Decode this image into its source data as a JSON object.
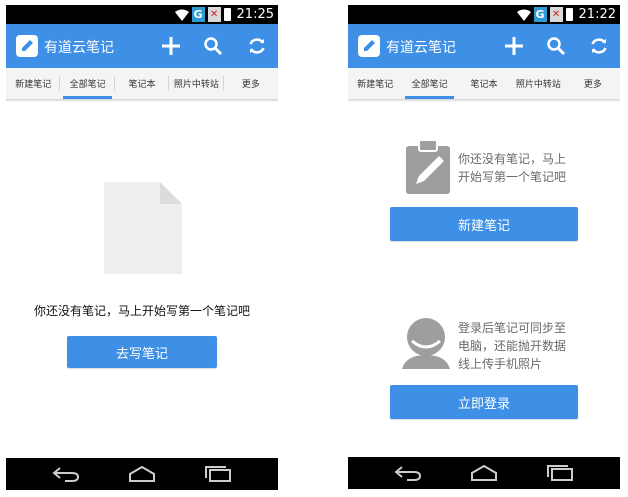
{
  "left": {
    "status": {
      "network": "G",
      "sim": "✕",
      "time": "21:25"
    },
    "app_title": "有道云笔记",
    "tabs": [
      "新建笔记",
      "全部笔记",
      "笔记本",
      "照片中转站",
      "更多"
    ],
    "active_tab": 1,
    "empty_message": "你还没有笔记，马上开始写第一个笔记吧",
    "write_button": "去写笔记"
  },
  "right": {
    "status": {
      "network": "G",
      "sim": "✕",
      "time": "21:22"
    },
    "app_title": "有道云笔记",
    "tabs": [
      "新建笔记",
      "全部笔记",
      "笔记本",
      "照片中转站",
      "更多"
    ],
    "active_tab": 1,
    "empty_message_lines": [
      "你还没有笔记，马上",
      "开始写第一个笔记吧"
    ],
    "new_note_button": "新建笔记",
    "login_message_lines": [
      "登录后笔记可同步至",
      "电脑，还能抛开数据",
      "线上传手机照片"
    ],
    "login_button": "立即登录"
  },
  "icons": {
    "toolbar": [
      "add-icon",
      "search-icon",
      "sync-icon"
    ],
    "nav": [
      "back-icon",
      "home-icon",
      "recent-apps-icon"
    ]
  },
  "colors": {
    "accent": "#3e8fe6",
    "tab_indicator": "#3e8fe6",
    "status_g": "#2f9bd5"
  }
}
